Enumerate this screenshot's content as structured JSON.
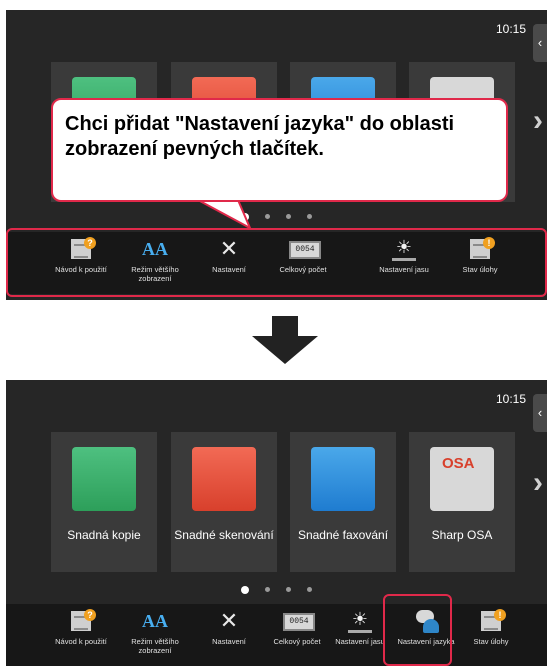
{
  "top_screen": {
    "clock": "10:15",
    "callout": "Chci přidat \"Nastavení jazyka\" do oblasti zobrazení pevných tlačítek.",
    "fixed_keys": [
      {
        "label": "Návod k použití",
        "icon": "help-document-icon"
      },
      {
        "label": "Režim většího zobrazení",
        "icon": "font-size-icon"
      },
      {
        "label": "Nastavení",
        "icon": "tools-icon"
      },
      {
        "label": "Celkový počet",
        "icon": "counter-icon"
      },
      {
        "label": "Nastavení jasu",
        "icon": "brightness-icon"
      },
      {
        "label": "Stav úlohy",
        "icon": "job-status-icon"
      }
    ]
  },
  "bottom_screen": {
    "clock": "10:15",
    "tiles": [
      {
        "label": "Snadná kopie",
        "icon": "easy-copy-icon",
        "color": "#3cb371"
      },
      {
        "label": "Snadné skenování",
        "icon": "easy-scan-icon",
        "color": "#e8503a"
      },
      {
        "label": "Snadné faxování",
        "icon": "easy-fax-icon",
        "color": "#2f8fe0"
      },
      {
        "label": "Sharp OSA",
        "icon": "sharp-osa-icon",
        "color": "#d0d0d0"
      }
    ],
    "fixed_keys": [
      {
        "label": "Návod k použití",
        "icon": "help-document-icon"
      },
      {
        "label": "Režim většího zobrazení",
        "icon": "font-size-icon"
      },
      {
        "label": "Nastavení",
        "icon": "tools-icon"
      },
      {
        "label": "Celkový počet",
        "icon": "counter-icon"
      },
      {
        "label": "Nastavení jasu",
        "icon": "brightness-icon"
      },
      {
        "label": "Nastavení jazyka",
        "icon": "language-settings-icon"
      },
      {
        "label": "Stav úlohy",
        "icon": "job-status-icon"
      }
    ]
  },
  "page_dots": {
    "count": 4,
    "active": 1
  },
  "glyphs": {
    "side_tab": "‹",
    "next": "›",
    "help_badge": "?",
    "status_badge": "!",
    "font_size": "AA",
    "tools": "✕",
    "counter": "0054",
    "sun": "☀",
    "osa": "OSA"
  },
  "colors": {
    "screen": "#262626",
    "tile": "#3a3a3a",
    "highlight": "#e0294a"
  }
}
